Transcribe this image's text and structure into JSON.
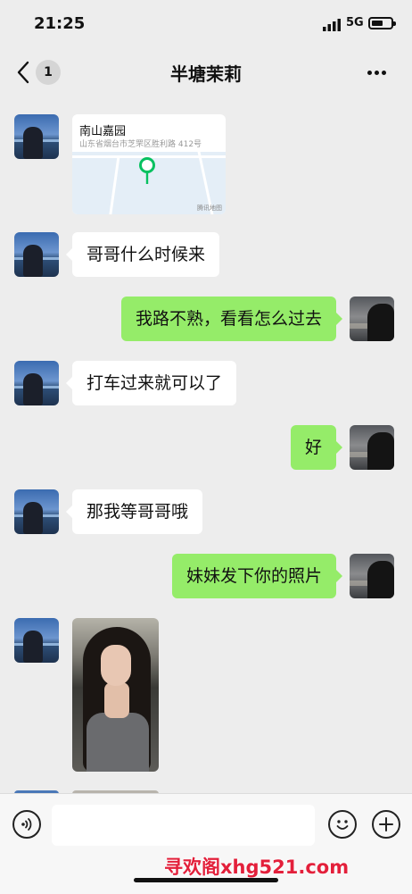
{
  "status": {
    "time": "21:25",
    "network": "5G"
  },
  "nav": {
    "unread": "1",
    "title": "半塘茉莉"
  },
  "messages": {
    "location": {
      "name": "南山嘉园",
      "address": "山东省烟台市芝罘区胜利路 412号",
      "map_brand": "腾讯地图"
    },
    "m1": "哥哥什么时候来",
    "m2": "我路不熟，看看怎么过去",
    "m3": "打车过来就可以了",
    "m4": "好",
    "m5": "那我等哥哥哦",
    "m6": "妹妹发下你的照片"
  },
  "input": {
    "placeholder": "",
    "value": ""
  },
  "watermark": "寻欢阁xhg521.com",
  "colors": {
    "sent_bubble": "#95ec69",
    "received_bubble": "#ffffff",
    "background": "#ededed",
    "watermark": "#e3203b"
  }
}
